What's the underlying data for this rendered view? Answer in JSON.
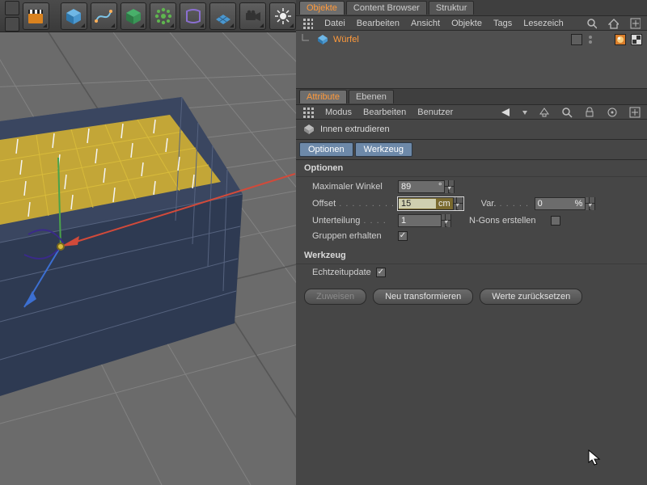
{
  "objects_panel": {
    "tabs": [
      "Objekte",
      "Content Browser",
      "Struktur"
    ],
    "active_tab": 0,
    "menu": [
      "Datei",
      "Bearbeiten",
      "Ansicht",
      "Objekte",
      "Tags",
      "Lesezeich"
    ],
    "object": {
      "name": "Würfel"
    }
  },
  "attributes_panel": {
    "tabs": [
      "Attribute",
      "Ebenen"
    ],
    "active_tab": 0,
    "menu": [
      "Modus",
      "Bearbeiten",
      "Benutzer"
    ],
    "tool_title": "Innen extrudieren",
    "subtabs": [
      "Optionen",
      "Werkzeug"
    ],
    "sections": {
      "optionen": {
        "header": "Optionen",
        "max_winkel": {
          "label": "Maximaler Winkel",
          "value": "89",
          "unit": "°"
        },
        "offset": {
          "label": "Offset",
          "value": "15",
          "unit": "cm"
        },
        "var": {
          "label": "Var.",
          "value": "0",
          "unit": "%"
        },
        "unterteilung": {
          "label": "Unterteilung",
          "value": "1",
          "unit": ""
        },
        "ngons": {
          "label": "N-Gons erstellen",
          "checked": false
        },
        "gruppen": {
          "label": "Gruppen erhalten",
          "checked": true
        }
      },
      "werkzeug": {
        "header": "Werkzeug",
        "echtzeit": {
          "label": "Echtzeitupdate",
          "checked": true
        },
        "buttons": {
          "zuweisen": "Zuweisen",
          "neu": "Neu transformieren",
          "reset": "Werte zurücksetzen"
        }
      }
    }
  }
}
